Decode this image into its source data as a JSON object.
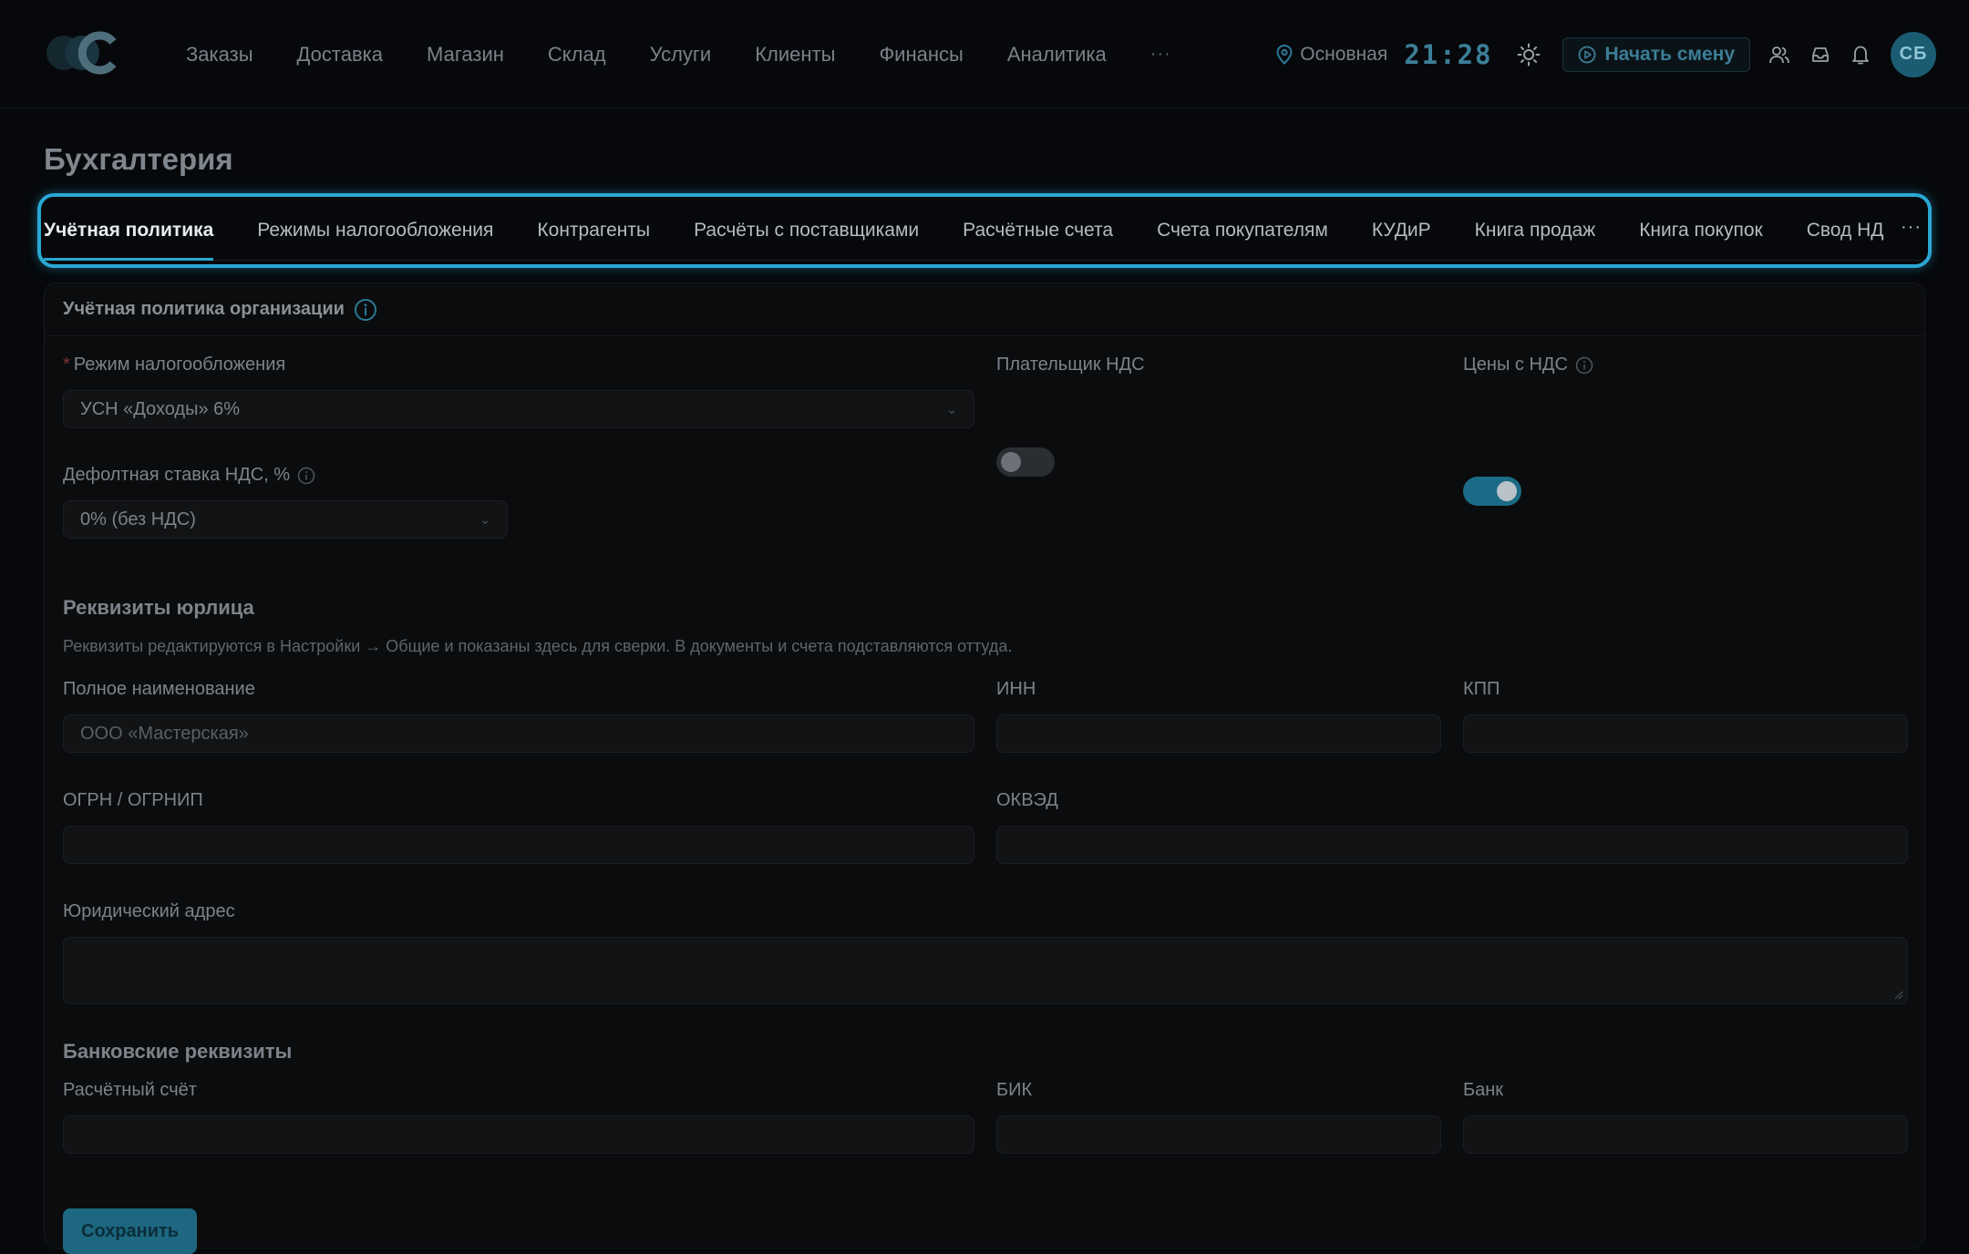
{
  "nav": {
    "items": [
      "Заказы",
      "Доставка",
      "Магазин",
      "Склад",
      "Услуги",
      "Клиенты",
      "Финансы",
      "Аналитика"
    ],
    "more": "···"
  },
  "topbar": {
    "location": "Основная",
    "clock": "21:28",
    "start_shift": "Начать смену",
    "avatar_initials": "СБ",
    "accent_color": "#2aa7d4"
  },
  "page": {
    "title": "Бухгалтерия"
  },
  "tabs": {
    "items": [
      "Учётная политика",
      "Режимы налогообложения",
      "Контрагенты",
      "Расчёты с поставщиками",
      "Расчётные счета",
      "Счета покупателям",
      "КУДиР",
      "Книга продаж",
      "Книга покупок",
      "Свод НД"
    ],
    "active": "Учётная политика",
    "more": "···"
  },
  "policy": {
    "card_title": "Учётная политика организации",
    "tax_mode_label": "Режим налогообложения",
    "tax_mode_required": "*",
    "tax_mode_value": "УСН «Доходы» 6%",
    "vat_payer_label": "Плательщик НДС",
    "vat_payer_on": false,
    "prices_with_vat_label": "Цены с НДС",
    "prices_with_vat_on": true,
    "default_vat_label": "Дефолтная ставка НДС, %",
    "default_vat_value": "0% (без НДС)"
  },
  "legal": {
    "title": "Реквизиты юрлица",
    "hint": "Реквизиты редактируются в Настройки → Общие и показаны здесь для сверки. В документы и счета подставляются оттуда.",
    "full_name_label": "Полное наименование",
    "full_name_value": "ООО «Мастерская»",
    "inn_label": "ИНН",
    "kpp_label": "КПП",
    "ogrn_label": "ОГРН / ОГРНИП",
    "okved_label": "ОКВЭД",
    "address_label": "Юридический адрес"
  },
  "bank": {
    "title": "Банковские реквизиты",
    "account_label": "Расчётный счёт",
    "bik_label": "БИК",
    "bank_label": "Банк"
  },
  "actions": {
    "save_label": "Сохранить"
  }
}
